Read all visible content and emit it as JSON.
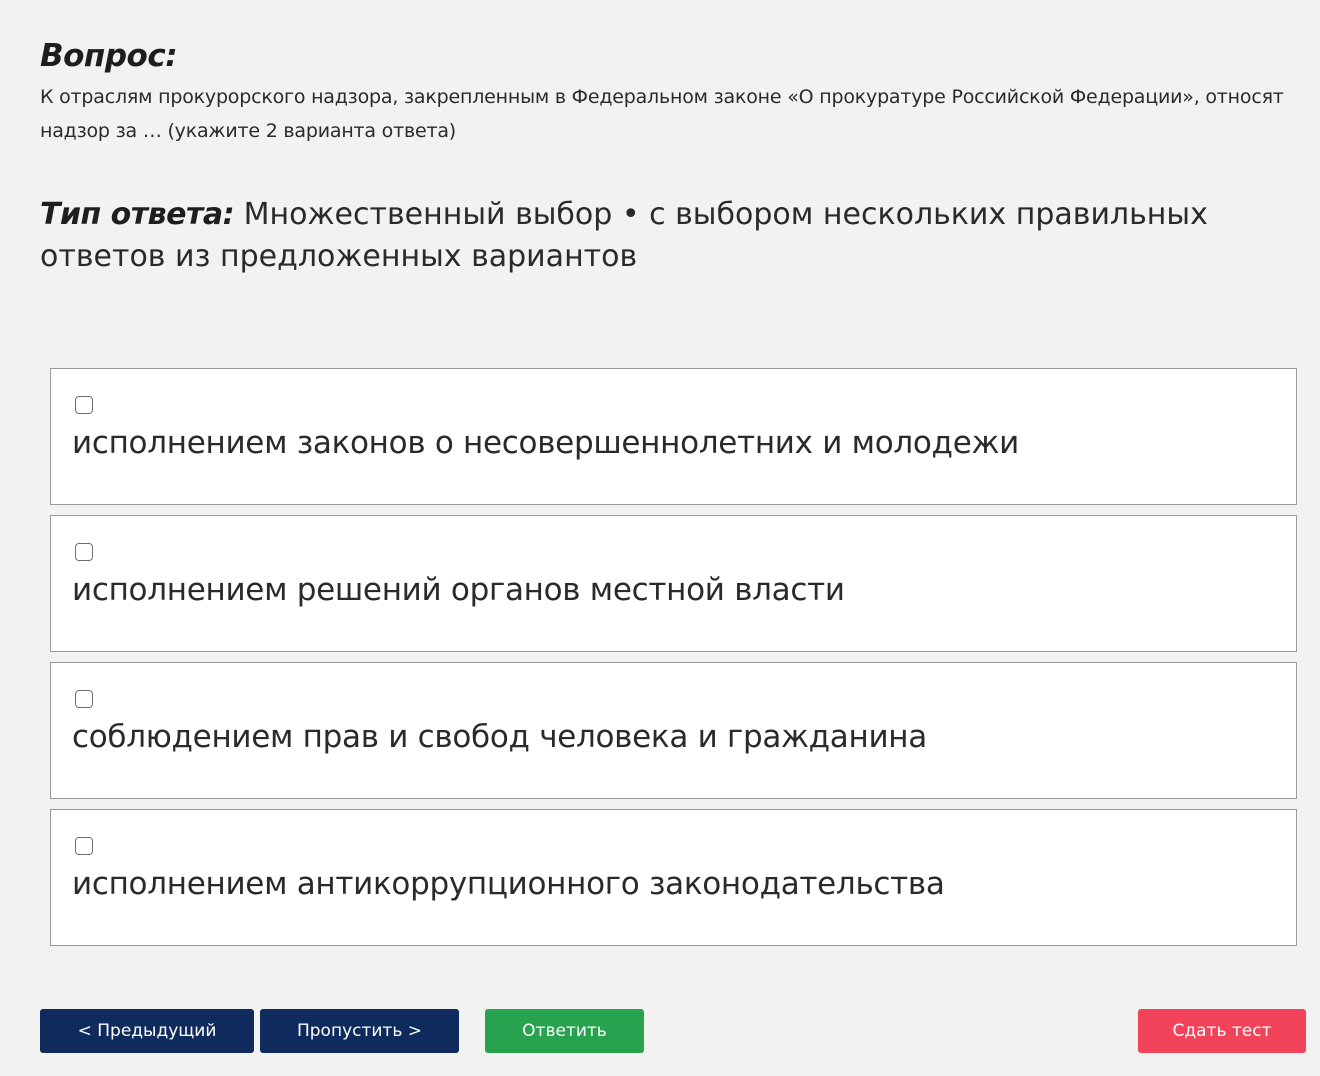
{
  "question": {
    "heading": "Вопрос:",
    "text": "К отраслям прокурорского надзора, закрепленным в Федеральном законе «О прокуратуре Российской Федерации», относят надзор за … (укажите 2 варианта ответа)"
  },
  "answer_type": {
    "label": "Тип ответа:",
    "value": "Множественный выбор • с выбором нескольких правильных ответов из предложенных вариантов"
  },
  "options": [
    {
      "label": "исполнением законов о несовершеннолетних и молодежи",
      "checked": false
    },
    {
      "label": "исполнением решений органов местной власти",
      "checked": false
    },
    {
      "label": "соблюдением прав и свобод человека и гражданина",
      "checked": false
    },
    {
      "label": "исполнением антикоррупционного законодательства",
      "checked": false
    }
  ],
  "buttons": {
    "prev": "< Предыдущий",
    "skip": "Пропустить >",
    "answer": "Ответить",
    "submit": "Сдать тест"
  },
  "colors": {
    "nav_button": "#0f2b5e",
    "answer_button": "#27a24f",
    "submit_button": "#f2435a",
    "background": "#f2f2f0"
  }
}
